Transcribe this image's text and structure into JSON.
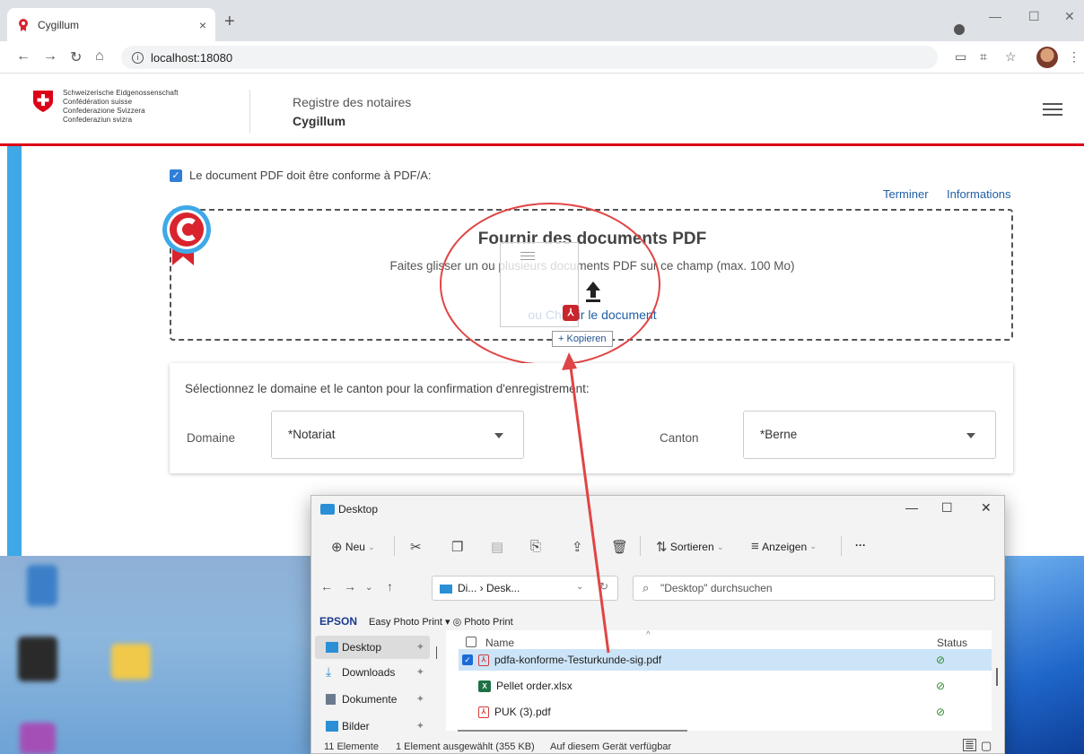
{
  "browser": {
    "tab_title": "Cygillum",
    "tab_close": "×",
    "new_tab": "+",
    "url": "localhost:18080",
    "win_min": "—",
    "win_max": "☐",
    "win_close": "✕"
  },
  "header": {
    "confederation": [
      "Schweizerische Eidgenossenschaft",
      "Confédération suisse",
      "Confederazione Svizzera",
      "Confederaziun svizra"
    ],
    "subtitle": "Registre des notaires",
    "title": "Cygillum"
  },
  "upload": {
    "pdfa_label": "Le document PDF doit être conforme à PDF/A:",
    "link_finish": "Terminer",
    "link_info": "Informations",
    "title": "Fournir des documents PDF",
    "hint": "Faites glisser un ou plusieurs documents PDF sur ce champ (max. 100 Mo)",
    "choose": "ou Choisir le document",
    "drag_tooltip": "+ Kopieren"
  },
  "selection": {
    "title": "Sélectionnez le domaine et le canton pour la confirmation d'enregistrement:",
    "domain_label": "Domaine",
    "domain_value": "*Notariat",
    "canton_label": "Canton",
    "canton_value": "*Berne"
  },
  "explorer": {
    "title": "Desktop",
    "win_min": "—",
    "win_max": "☐",
    "win_close": "✕",
    "toolbar": {
      "new": "Neu",
      "sort": "Sortieren",
      "view": "Anzeigen",
      "more": "···"
    },
    "address": "Di... › Desk...",
    "search_placeholder": "\"Desktop\" durchsuchen",
    "epson_brand": "EPSON",
    "epson_rest": "Easy Photo Print ▾ ◎ Photo Print",
    "nav": [
      {
        "label": "Desktop"
      },
      {
        "label": "Downloads"
      },
      {
        "label": "Dokumente"
      },
      {
        "label": "Bilder"
      }
    ],
    "columns": {
      "name": "Name",
      "status": "Status"
    },
    "files": [
      {
        "name": "pdfa-konforme-Testurkunde-sig.pdf",
        "type": "pdf",
        "status": "⊘"
      },
      {
        "name": "Pellet order.xlsx",
        "type": "xlsx",
        "status": "⊘"
      },
      {
        "name": "PUK (3).pdf",
        "type": "pdf",
        "status": "⊘"
      }
    ],
    "status_bar": {
      "count": "11 Elemente",
      "selected": "1 Element ausgewählt (355 KB)",
      "availability": "Auf diesem Gerät verfügbar"
    }
  },
  "colors": {
    "swiss_red": "#dc0018",
    "accent_blue": "#1f5fa6",
    "side_bar": "#3fa9e7",
    "annotation_red": "#e04545"
  }
}
